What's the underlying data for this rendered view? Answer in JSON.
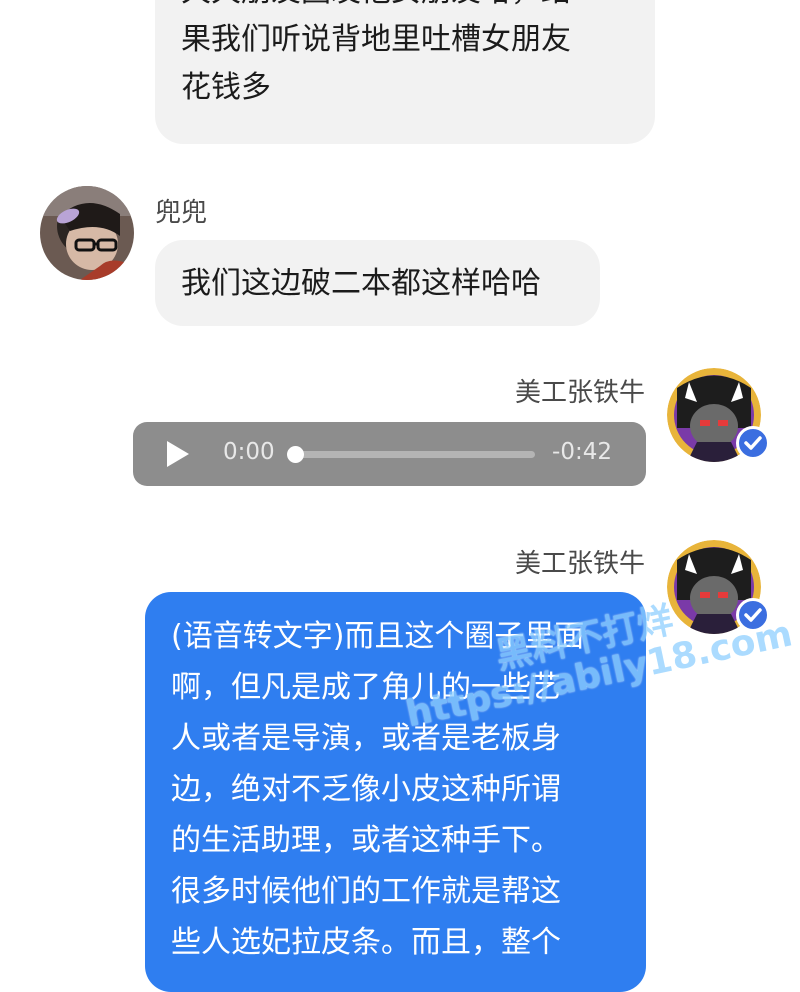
{
  "messages": {
    "m1": {
      "line1": "天天朋友圈发他女朋友哈，结",
      "line2": "果我们听说背地里吐槽女朋友",
      "line3": "花钱多"
    },
    "m2": {
      "sender": "兜兜",
      "text": "我们这边破二本都这样哈哈"
    },
    "m3": {
      "sender": "美工张铁牛",
      "audio": {
        "elapsed": "0:00",
        "remaining": "-0:42",
        "progress_fraction": 0.0
      }
    },
    "m4": {
      "sender": "美工张铁牛",
      "lines": [
        "(语音转文字)而且这个圈子里面",
        "啊，但凡是成了角儿的一些艺",
        "人或者是导演，或者是老板身",
        "边，绝对不乏像小皮这种所谓",
        "的生活助理，或者这种手下。",
        "很多时候他们的工作就是帮这",
        "些人选妃拉皮条。而且，整个"
      ]
    }
  },
  "watermark": {
    "line1": "黑料不打烊",
    "line2": "https://abily18.com"
  },
  "colors": {
    "bubble_left": "#f2f2f2",
    "bubble_right": "#2f7ef0",
    "audio_bg": "#8d8d8d",
    "verified_badge": "#3b6ee0"
  },
  "icons": {
    "play": "play-icon",
    "verified": "verified-check-icon"
  }
}
